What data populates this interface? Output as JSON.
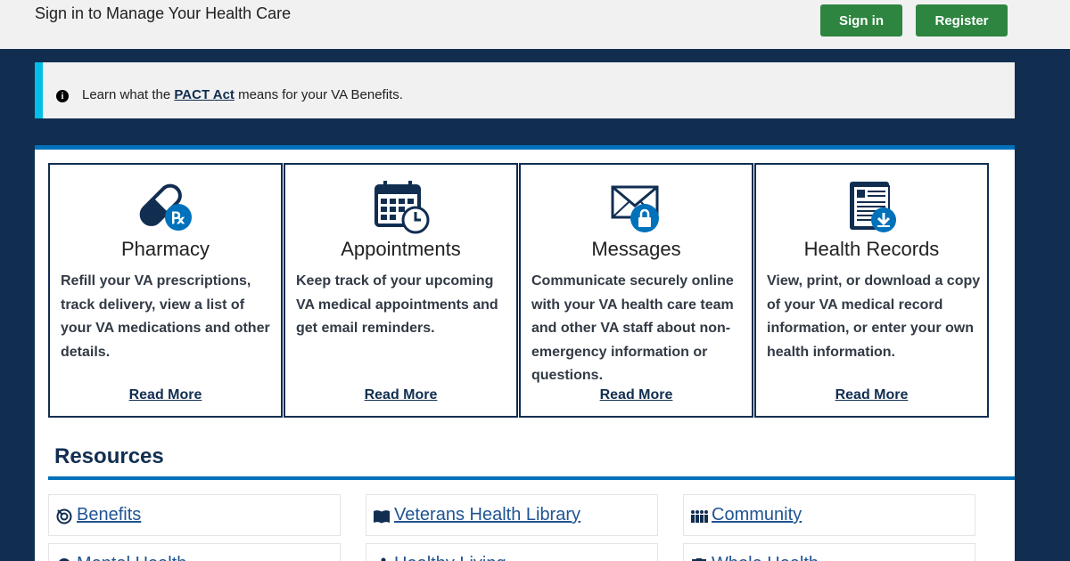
{
  "header": {
    "title": "Sign in to Manage Your Health Care",
    "signin_label": "Sign in",
    "register_label": "Register"
  },
  "alert": {
    "text_before": "Learn what the ",
    "link_text": "PACT Act",
    "text_after": " means for your VA Benefits.",
    "icon": "info-icon"
  },
  "cards": [
    {
      "title": "Pharmacy",
      "description": "Refill your VA prescriptions, track delivery, view a list of your VA medications and other details.",
      "link": "Read More",
      "icon": "pharmacy-pill-rx-icon"
    },
    {
      "title": "Appointments",
      "description": "Keep track of your upcoming VA medical appointments and get email reminders.",
      "link": "Read More",
      "icon": "calendar-clock-icon"
    },
    {
      "title": "Messages",
      "description": "Communicate securely online with your VA health care team and other VA staff about non-emergency information or questions.",
      "link": "Read More",
      "icon": "envelope-lock-icon"
    },
    {
      "title": "Health Records",
      "description": "View, print, or download a copy of your VA medical record information, or enter your own health information.",
      "link": "Read More",
      "icon": "record-download-icon"
    }
  ],
  "resources": {
    "title": "Resources",
    "items": [
      {
        "label": "Benefits",
        "icon": "benefits-icon"
      },
      {
        "label": "Veterans Health Library",
        "icon": "book-icon"
      },
      {
        "label": "Community",
        "icon": "community-icon"
      },
      {
        "label": "Mental Health",
        "icon": "head-icon"
      },
      {
        "label": "Healthy Living",
        "icon": "running-icon"
      },
      {
        "label": "Whole Health",
        "icon": "clipboard-icon"
      }
    ]
  },
  "colors": {
    "navy": "#112e51",
    "green": "#2e8540",
    "accent_blue": "#0071bb",
    "alert_cyan": "#02bfe7",
    "link": "#205493"
  }
}
